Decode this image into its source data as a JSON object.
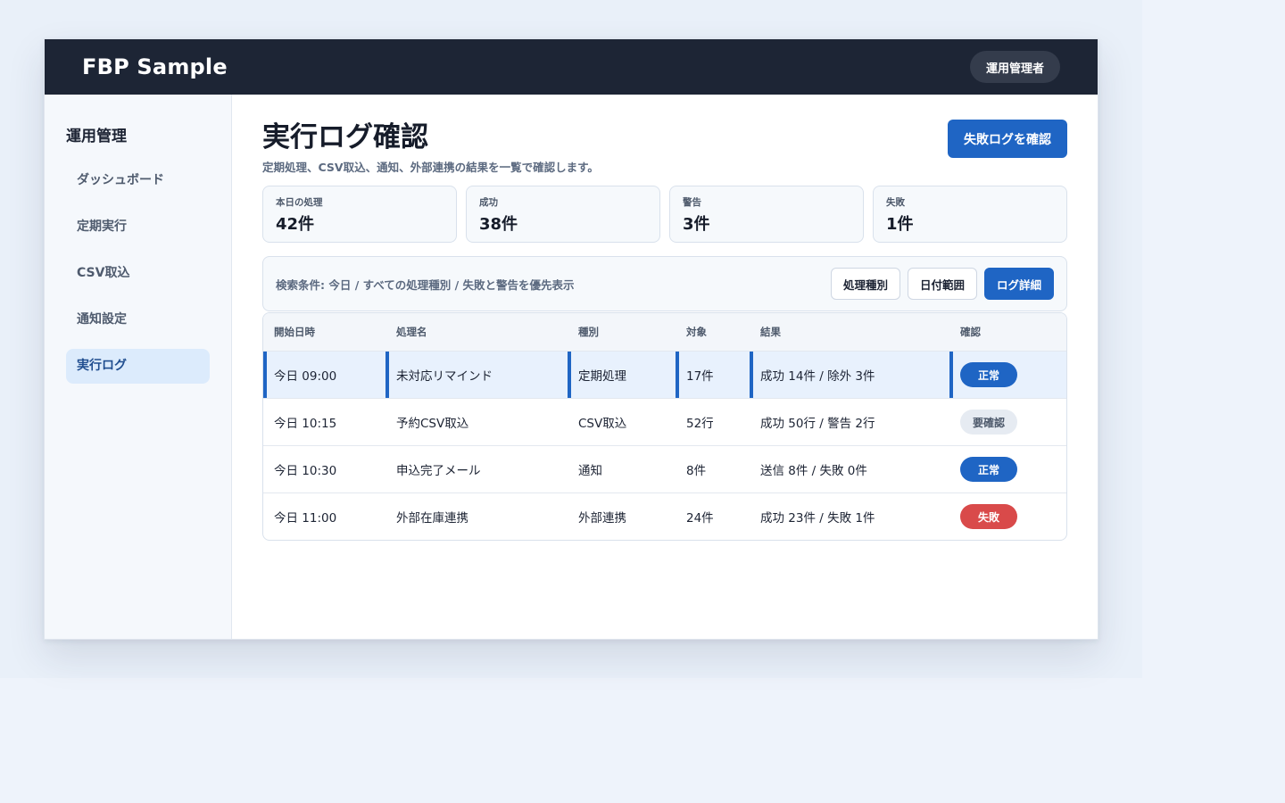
{
  "app": {
    "brand": "FBP Sample",
    "user_role": "運用管理者"
  },
  "sidebar": {
    "title": "運用管理",
    "items": [
      {
        "label": "ダッシュボード",
        "active": false
      },
      {
        "label": "定期実行",
        "active": false
      },
      {
        "label": "CSV取込",
        "active": false
      },
      {
        "label": "通知設定",
        "active": false
      },
      {
        "label": "実行ログ",
        "active": true
      }
    ]
  },
  "page": {
    "title": "実行ログ確認",
    "subtitle": "定期処理、CSV取込、通知、外部連携の結果を一覧で確認します。",
    "primary_action": "失敗ログを確認"
  },
  "stats": [
    {
      "label": "本日の処理",
      "value": "42件"
    },
    {
      "label": "成功",
      "value": "38件"
    },
    {
      "label": "警告",
      "value": "3件"
    },
    {
      "label": "失敗",
      "value": "1件"
    }
  ],
  "filter": {
    "text": "検索条件: 今日 / すべての処理種別 / 失敗と警告を優先表示",
    "buttons": [
      "処理種別",
      "日付範囲",
      "ログ詳細"
    ]
  },
  "table": {
    "columns": [
      "開始日時",
      "処理名",
      "種別",
      "対象",
      "結果",
      "確認"
    ],
    "rows": [
      {
        "start": "今日 09:00",
        "name": "未対応リマインド",
        "type": "定期処理",
        "target": "17件",
        "result": "成功 14件 / 除外 3件",
        "status": "正常",
        "status_kind": "ok",
        "selected": true
      },
      {
        "start": "今日 10:15",
        "name": "予約CSV取込",
        "type": "CSV取込",
        "target": "52行",
        "result": "成功 50行 / 警告 2行",
        "status": "要確認",
        "status_kind": "warn",
        "selected": false
      },
      {
        "start": "今日 10:30",
        "name": "申込完了メール",
        "type": "通知",
        "target": "8件",
        "result": "送信 8件 / 失敗 0件",
        "status": "正常",
        "status_kind": "ok",
        "selected": false
      },
      {
        "start": "今日 11:00",
        "name": "外部在庫連携",
        "type": "外部連携",
        "target": "24件",
        "result": "成功 23件 / 失敗 1件",
        "status": "失敗",
        "status_kind": "fail",
        "selected": false
      }
    ]
  },
  "colors": {
    "accent": "#1f65c4",
    "topbar": "#1d2535",
    "danger": "#d94a4a",
    "selected_row": "#e8f1fd"
  }
}
